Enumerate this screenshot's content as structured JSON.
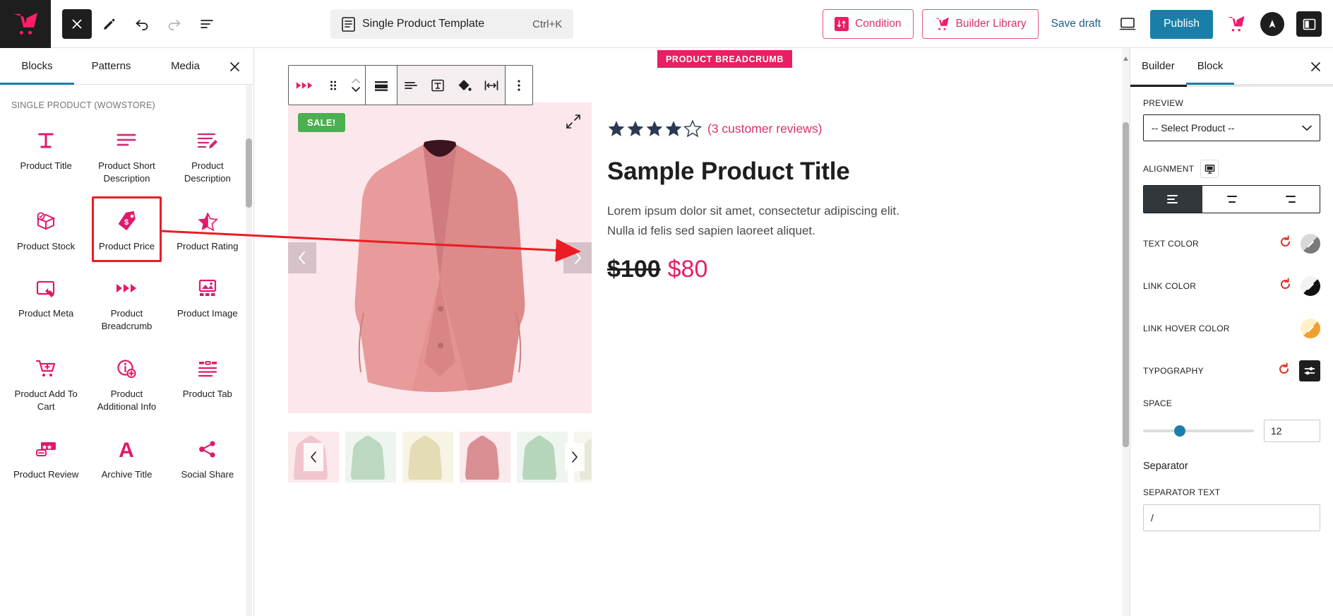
{
  "topbar": {
    "logo_icon": "wowstore-cart-logo",
    "close_label": "close-editor",
    "tools": [
      {
        "name": "edit-pencil-icon",
        "title": "Edit"
      },
      {
        "name": "undo-icon",
        "title": "Undo"
      },
      {
        "name": "redo-icon",
        "title": "Redo"
      },
      {
        "name": "document-overview-icon",
        "title": "Document Overview"
      }
    ],
    "document": {
      "icon": "template-document-icon",
      "title": "Single Product Template",
      "shortcut": "Ctrl+K"
    },
    "condition_label": "Condition",
    "builder_library_label": "Builder Library",
    "save_draft_label": "Save draft",
    "preview_icon": "desktop-preview-icon",
    "publish_label": "Publish",
    "wowstore_icon": "wowstore-cart-icon",
    "astra_icon": "astra-logo-icon",
    "settings_panel_icon": "sidebar-toggle-icon",
    "accent_pink": "#e91e63",
    "publish_blue": "#1a7fa8"
  },
  "left_panel": {
    "tabs": [
      {
        "label": "Blocks",
        "active": true
      },
      {
        "label": "Patterns",
        "active": false
      },
      {
        "label": "Media",
        "active": false
      }
    ],
    "close_icon": "close-icon",
    "section_title": "SINGLE PRODUCT (WOWSTORE)",
    "blocks": [
      {
        "label": "Product Title",
        "icon": "title-t-icon",
        "highlight": false
      },
      {
        "label": "Product Short Description",
        "icon": "short-description-lines-icon",
        "highlight": false
      },
      {
        "label": "Product Description",
        "icon": "description-pencil-icon",
        "highlight": false
      },
      {
        "label": "Product Stock",
        "icon": "stock-box-check-icon",
        "highlight": false
      },
      {
        "label": "Product Price",
        "icon": "price-tag-icon",
        "highlight": true
      },
      {
        "label": "Product Rating",
        "icon": "star-rating-icon",
        "highlight": false
      },
      {
        "label": "Product Meta",
        "icon": "meta-tag-icon",
        "highlight": false
      },
      {
        "label": "Product Breadcrumb",
        "icon": "breadcrumb-arrows-icon",
        "highlight": false
      },
      {
        "label": "Product Image",
        "icon": "image-gallery-icon",
        "highlight": false
      },
      {
        "label": "Product Add To Cart",
        "icon": "add-to-cart-icon",
        "highlight": false
      },
      {
        "label": "Product Additional Info",
        "icon": "info-circle-plus-icon",
        "highlight": false
      },
      {
        "label": "Product Tab",
        "icon": "product-tab-icon",
        "highlight": false
      },
      {
        "label": "Product Review",
        "icon": "review-comment-icon",
        "highlight": false
      },
      {
        "label": "Archive Title",
        "icon": "archive-title-a-icon",
        "highlight": false
      },
      {
        "label": "Social Share",
        "icon": "social-share-icon",
        "highlight": false
      }
    ]
  },
  "canvas": {
    "block_badge": "PRODUCT BREADCRUMB",
    "block_toolbar": [
      {
        "name": "block-type-breadcrumb-icon"
      },
      {
        "name": "drag-handle-icon"
      },
      {
        "name": "move-up-down-icon"
      },
      {
        "name": "change-alignment-icon"
      },
      {
        "name": "text-align-icon"
      },
      {
        "name": "text-box-icon"
      },
      {
        "name": "fill-color-icon"
      },
      {
        "name": "width-arrows-icon"
      },
      {
        "name": "more-options-icon"
      }
    ],
    "product": {
      "sale_badge": "SALE!",
      "expand_icon": "expand-arrows-icon",
      "prev_icon": "chevron-left-icon",
      "next_icon": "chevron-right-icon",
      "rating_filled": 4,
      "rating_total": 5,
      "reviews_text": "(3 customer reviews)",
      "title": "Sample Product Title",
      "description": "Lorem ipsum dolor sit amet, consectetur adipiscing elit. Nulla id felis sed sapien laoreet aliquet.",
      "price_old": "$100",
      "price_new": "$80",
      "gallery_bg": "#fce8ec",
      "thumbnails": [
        "#f0c5cd",
        "#bcd8c0",
        "#e3dcb4",
        "#d98f92",
        "#b6d6bb",
        "#e8e8d8"
      ]
    }
  },
  "right_panel": {
    "tabs": [
      {
        "label": "Builder",
        "active": false
      },
      {
        "label": "Block",
        "active": true
      }
    ],
    "close_icon": "close-icon",
    "preview_label": "PREVIEW",
    "preview_value": "-- Select Product --",
    "alignment_label": "ALIGNMENT",
    "alignment_device_icon": "desktop-device-icon",
    "alignment_options": [
      {
        "name": "align-left",
        "selected": true
      },
      {
        "name": "align-center",
        "selected": false
      },
      {
        "name": "align-right",
        "selected": false
      }
    ],
    "controls": [
      {
        "label": "TEXT COLOR",
        "reset": true,
        "swatch": "sw-gray"
      },
      {
        "label": "LINK COLOR",
        "reset": true,
        "swatch": "sw-black"
      },
      {
        "label": "LINK HOVER COLOR",
        "reset": false,
        "swatch": "sw-orange"
      }
    ],
    "typography_label": "TYPOGRAPHY",
    "space_label": "SPACE",
    "space_value": "12",
    "separator_label": "Separator",
    "separator_text_label": "SEPARATOR TEXT",
    "separator_text_value": "/"
  }
}
